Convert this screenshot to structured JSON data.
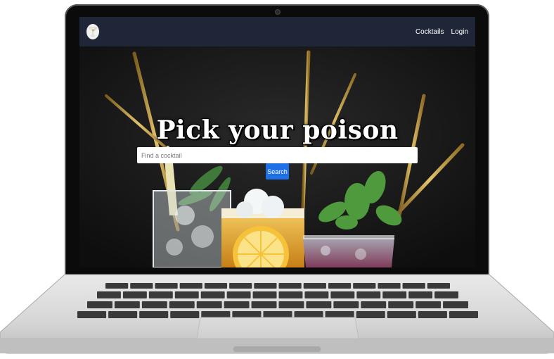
{
  "navbar": {
    "logo_icon": "cocktail-glass-icon",
    "links": [
      {
        "label": "Cocktails"
      },
      {
        "label": "Login"
      }
    ]
  },
  "hero": {
    "headline": "Pick your poison",
    "search": {
      "placeholder": "Find a cocktail",
      "value": ""
    },
    "search_button_label": "Search"
  },
  "colors": {
    "navbar": "#1e2638",
    "button": "#1f6fe5",
    "headline": "#ffffff"
  }
}
